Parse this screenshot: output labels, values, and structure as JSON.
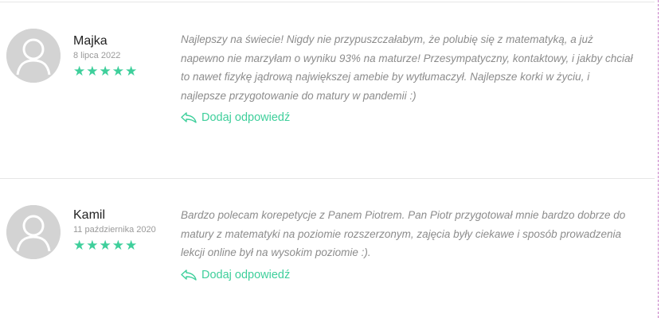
{
  "colors": {
    "accent": "#3ecf9b",
    "text_muted": "#8c8c8c",
    "avatar_bg": "#d3d3d3"
  },
  "reviews": [
    {
      "name": "Majka",
      "date": "8 lipca 2022",
      "rating": 5,
      "text": "Najlepszy na świecie! Nigdy nie przypuszczałabym, że polubię się z matematyką, a już napewno nie marzyłam o wyniku 93% na maturze! Przesympatyczny, kontaktowy, i jakby chciał to nawet fizykę jądrową największej amebie by wytłumaczył. Najlepsze korki w życiu, i najlepsze przygotowanie do matury w pandemii :)",
      "reply_label": "Dodaj odpowiedź"
    },
    {
      "name": "Kamil",
      "date": "11 października 2020",
      "rating": 5,
      "text": "Bardzo polecam korepetycje z Panem Piotrem. Pan Piotr przygotował mnie bardzo dobrze do matury z matematyki na poziomie rozszerzonym, zajęcia były ciekawe i sposób prowadzenia lekcji online był na wysokim poziomie :).",
      "reply_label": "Dodaj odpowiedź"
    }
  ],
  "icons": {
    "avatar": "user-silhouette-icon",
    "star": "star-icon",
    "reply": "reply-arrow-icon"
  }
}
